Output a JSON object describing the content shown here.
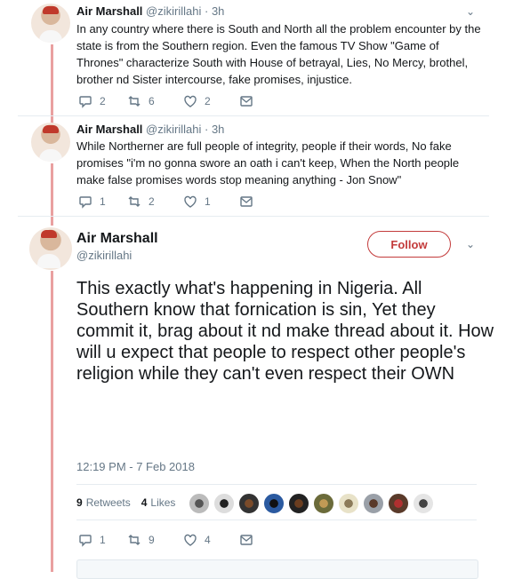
{
  "tweets": [
    {
      "name": "Air Marshall",
      "handle": "@zikirillahi",
      "time": "· 3h",
      "text": "In any country where there is South and North all the problem encounter by the state is from the Southern region. Even the famous TV Show \"Game of Thrones\" characterize South with House of betrayal, Lies, No Mercy, brothel, brother nd Sister intercourse, fake promises, injustice.",
      "replies": "2",
      "retweets": "6",
      "likes": "2"
    },
    {
      "name": "Air Marshall",
      "handle": "@zikirillahi",
      "time": "· 3h",
      "text": "While Northerner are full people of integrity, people if their words, No fake promises \"i'm no gonna swore an oath i can't keep, When the North people make false promises words stop meaning anything - Jon Snow\"",
      "replies": "1",
      "retweets": "2",
      "likes": "1"
    }
  ],
  "main": {
    "name": "Air Marshall",
    "handle": "@zikirillahi",
    "follow_label": "Follow",
    "text": "This exactly what's happening in Nigeria. All Southern know that fornication is sin, Yet they commit it, brag about it nd make thread about it. How will u expect that people to respect other people's religion while they can't even respect their OWN",
    "timestamp": "12:19 PM - 7 Feb 2018",
    "retweets_count": "9",
    "retweets_label": "Retweets",
    "likes_count": "4",
    "likes_label": "Likes",
    "replies": "1",
    "retweets": "9",
    "likes": "4"
  },
  "colors": {
    "accent": "#c33b3b",
    "thread_line": "#e9a0a0",
    "muted": "#657786"
  },
  "icons": [
    "reply-icon",
    "retweet-icon",
    "heart-icon",
    "message-icon",
    "chevron-down-icon"
  ]
}
